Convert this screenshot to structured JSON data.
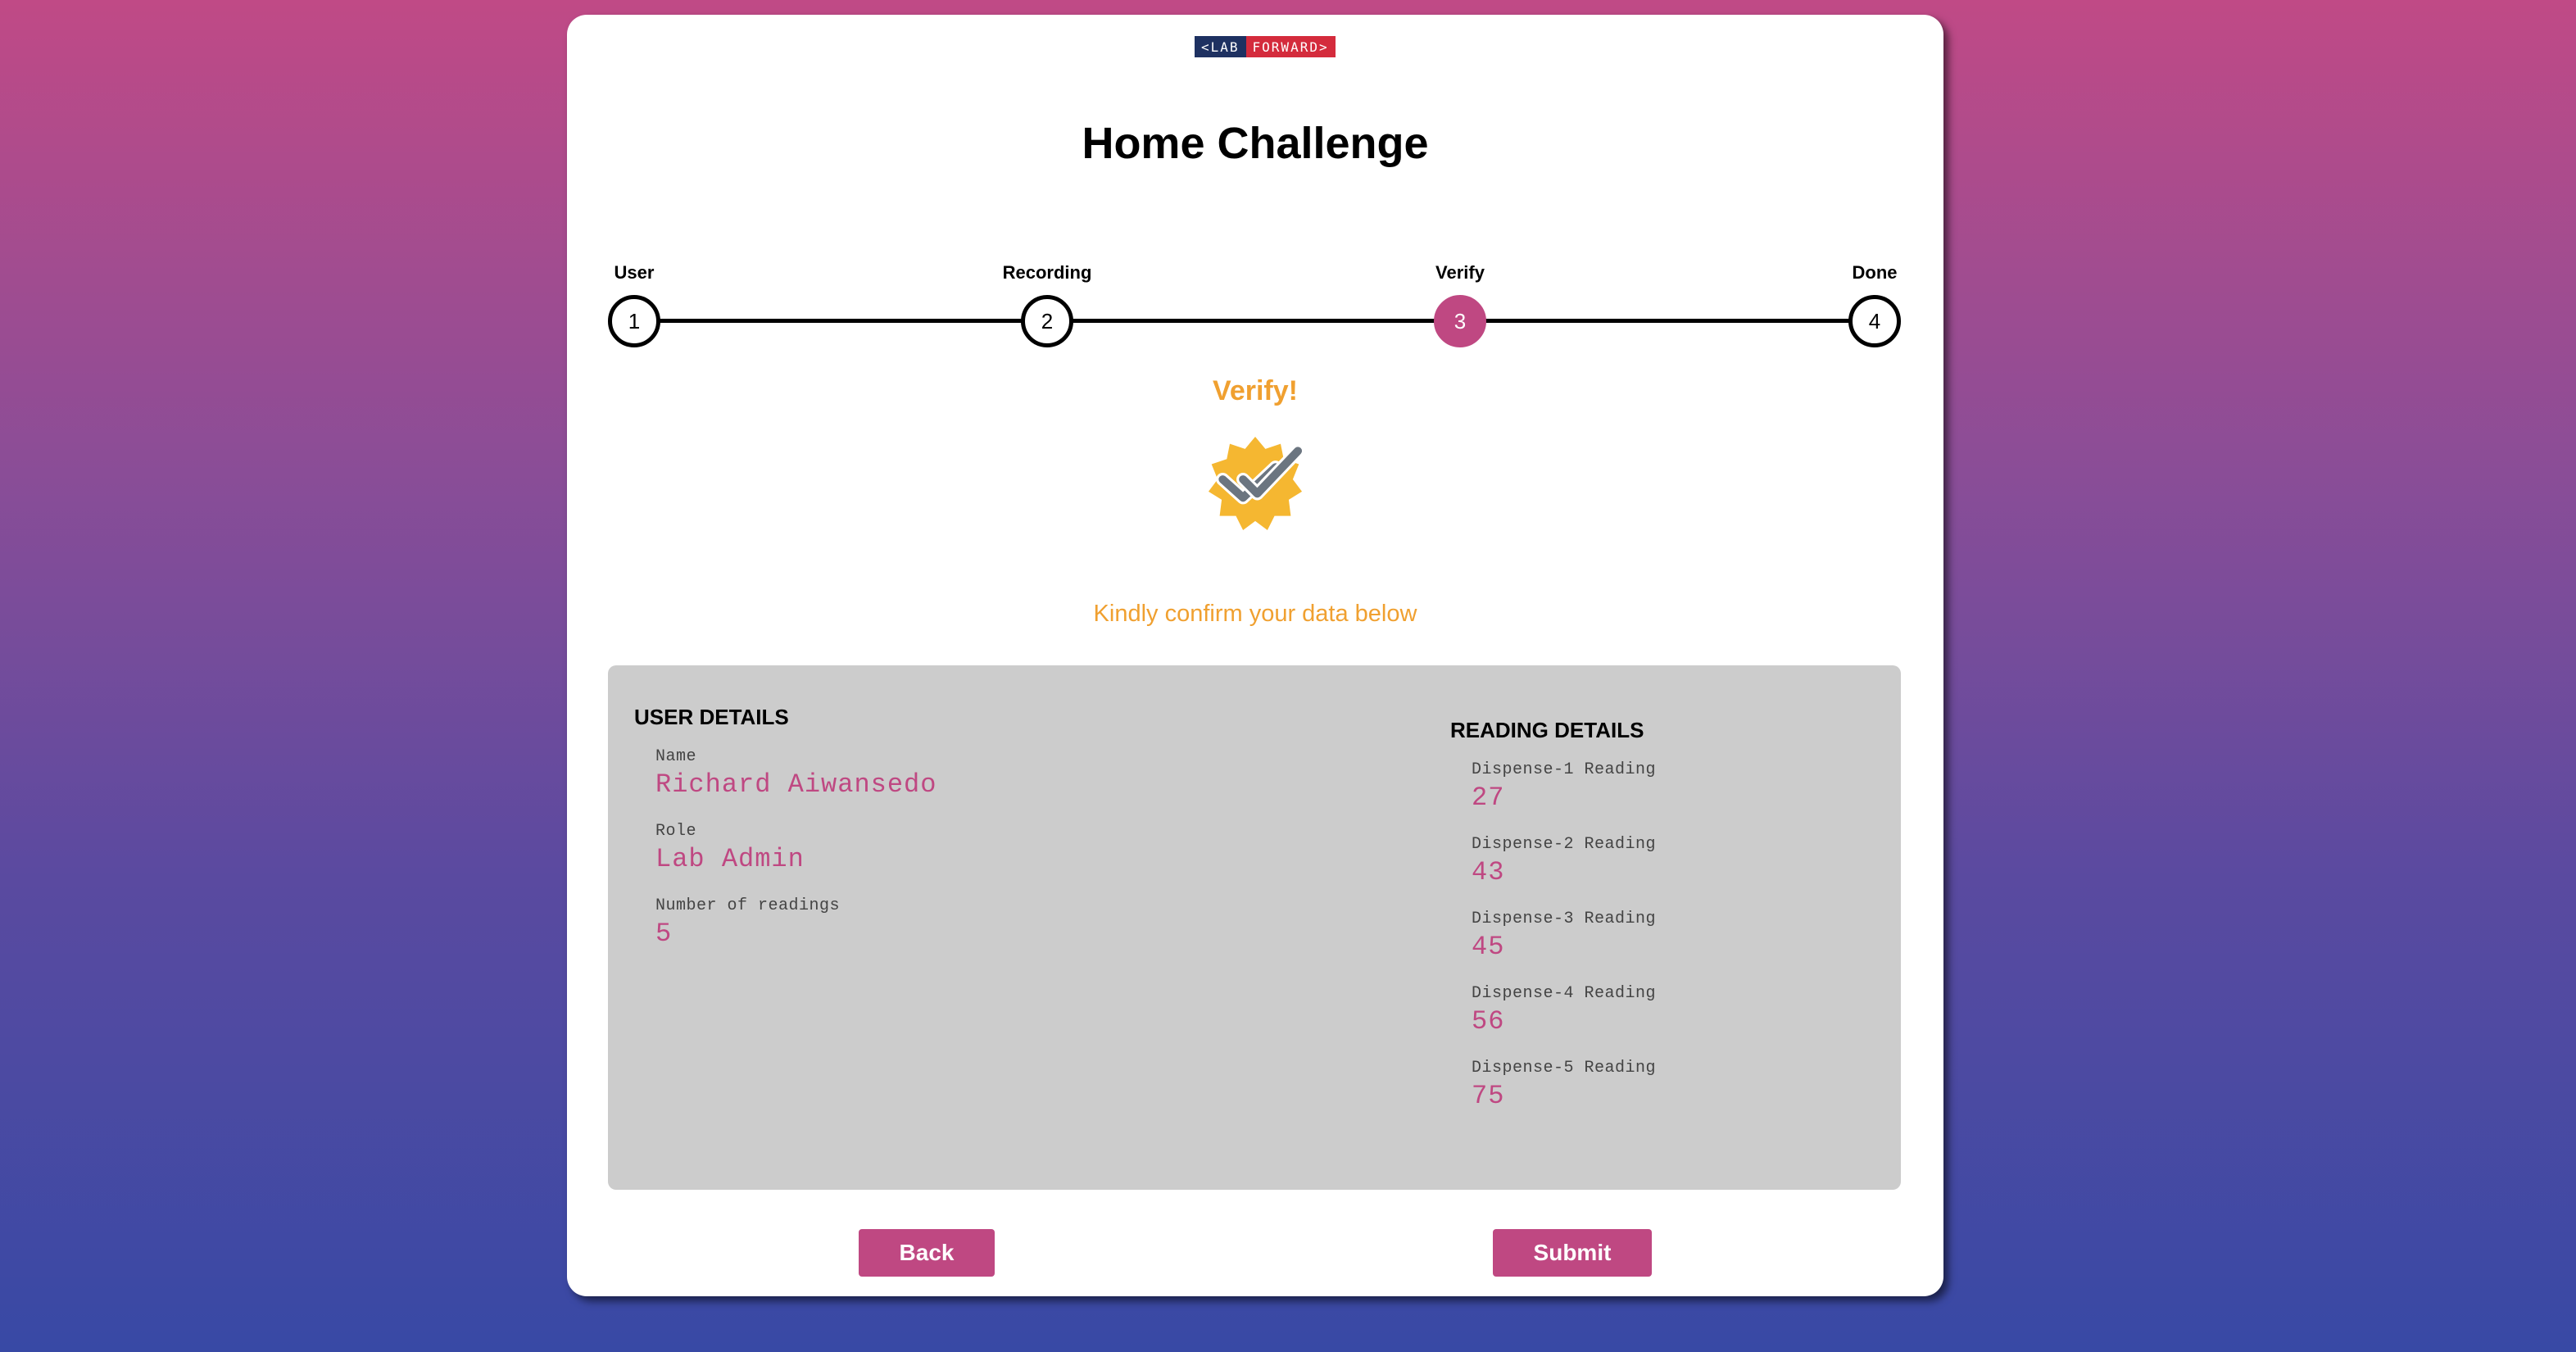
{
  "logo": {
    "left": "<LAB",
    "right": "FORWARD>"
  },
  "page_title": "Home Challenge",
  "steps": [
    {
      "number": "1",
      "label": "User",
      "active": false
    },
    {
      "number": "2",
      "label": "Recording",
      "active": false
    },
    {
      "number": "3",
      "label": "Verify",
      "active": true
    },
    {
      "number": "4",
      "label": "Done",
      "active": false
    }
  ],
  "verify_heading": "Verify!",
  "badge_icon": "verified-badge-icon",
  "subtitle": "Kindly confirm your data below",
  "user_details": {
    "title": "USER DETAILS",
    "fields": [
      {
        "label": "Name",
        "value": "Richard Aiwansedo"
      },
      {
        "label": "Role",
        "value": "Lab Admin"
      },
      {
        "label": "Number of readings",
        "value": "5"
      }
    ]
  },
  "reading_details": {
    "title": "READING DETAILS",
    "fields": [
      {
        "label": "Dispense-1 Reading",
        "value": "27"
      },
      {
        "label": "Dispense-2 Reading",
        "value": "43"
      },
      {
        "label": "Dispense-3 Reading",
        "value": "45"
      },
      {
        "label": "Dispense-4 Reading",
        "value": "56"
      },
      {
        "label": "Dispense-5 Reading",
        "value": "75"
      }
    ]
  },
  "buttons": {
    "back": "Back",
    "submit": "Submit"
  },
  "colors": {
    "accent": "#bf4882",
    "highlight": "#f0a030",
    "panel": "#cccccc"
  }
}
